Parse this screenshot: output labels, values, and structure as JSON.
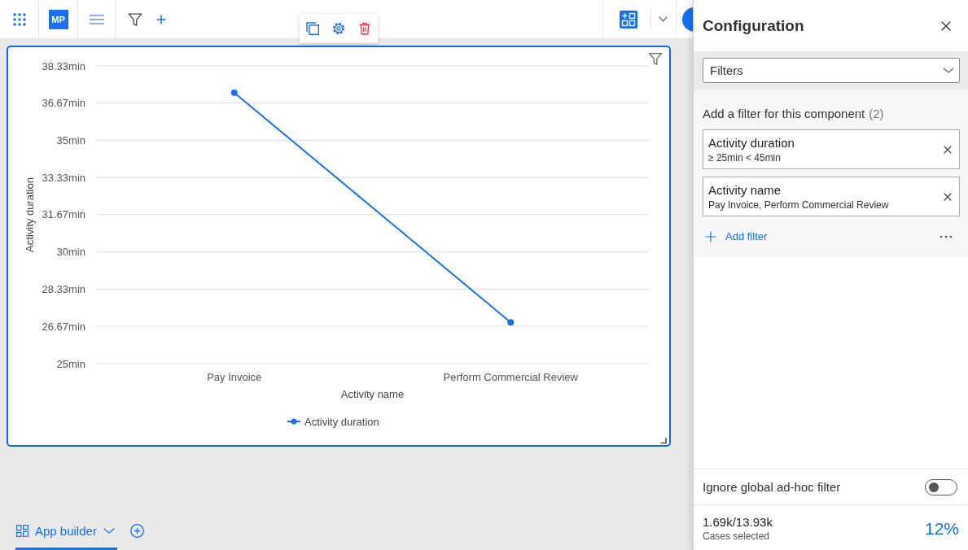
{
  "top_bar": {
    "app_badge": "MP"
  },
  "chart_card": {
    "chart_data": {
      "type": "line",
      "xlabel": "Activity name",
      "ylabel": "Activity duration",
      "grid": true,
      "categories": [
        "Pay Invoice",
        "Perform Commercial Review"
      ],
      "series": [
        {
          "name": "Activity duration",
          "color": "#1a6fef",
          "marker": "circle",
          "values": [
            37.13,
            26.85
          ]
        }
      ],
      "ylim": [
        25,
        38.33
      ],
      "yticks": [
        {
          "value": 25,
          "label": "25min"
        },
        {
          "value": 26.67,
          "label": "26.67min"
        },
        {
          "value": 28.33,
          "label": "28.33min"
        },
        {
          "value": 30,
          "label": "30min"
        },
        {
          "value": 31.67,
          "label": "31.67min"
        },
        {
          "value": 33.33,
          "label": "33.33min"
        },
        {
          "value": 35,
          "label": "35min"
        },
        {
          "value": 36.67,
          "label": "36.67min"
        },
        {
          "value": 38.33,
          "label": "38.33min"
        }
      ]
    }
  },
  "page_tabs": [
    {
      "label": "App builder",
      "selected": true
    }
  ],
  "config_panel": {
    "title": "Configuration",
    "section_select": {
      "value": "Filters"
    },
    "filter_heading": "Add a filter for this component",
    "filter_count": "(2)",
    "filters": [
      {
        "name": "Activity duration",
        "value": "≥ 25min < 45min"
      },
      {
        "name": "Activity name",
        "value": "Pay Invoice, Perform Commercial Review"
      }
    ],
    "add_filter": "Add filter",
    "ignore_global_filter": {
      "label": "Ignore global ad-hoc filter",
      "on": false
    },
    "cases": {
      "value": "1.69k/13.93k",
      "label": "Cases selected",
      "percent": "12%"
    }
  }
}
